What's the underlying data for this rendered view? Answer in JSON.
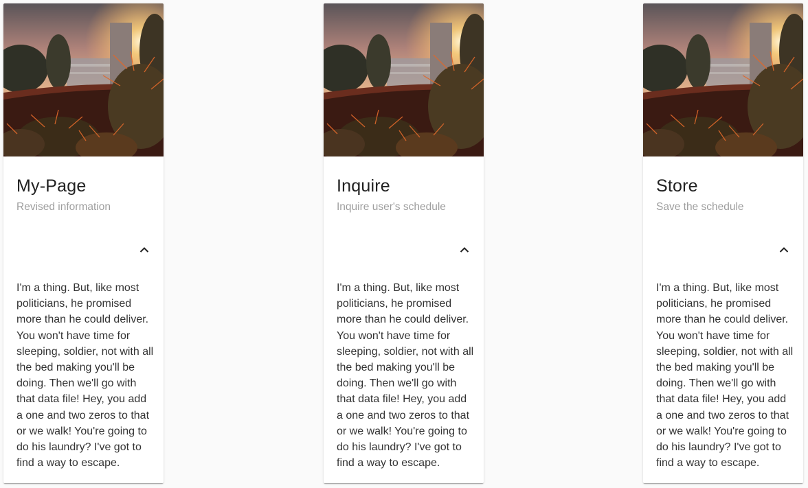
{
  "cards": [
    {
      "title": "My-Page",
      "subtitle": "Revised information",
      "expand_icon": "chevron-up-icon",
      "body": "I'm a thing. But, like most politicians, he promised more than he could deliver. You won't have time for sleeping, soldier, not with all the bed making you'll be doing. Then we'll go with that data file! Hey, you add a one and two zeros to that or we walk! You're going to do his laundry? I've got to find a way to escape."
    },
    {
      "title": "Inquire",
      "subtitle": "Inquire user's schedule",
      "expand_icon": "chevron-up-icon",
      "body": "I'm a thing. But, like most politicians, he promised more than he could deliver. You won't have time for sleeping, soldier, not with all the bed making you'll be doing. Then we'll go with that data file! Hey, you add a one and two zeros to that or we walk! You're going to do his laundry? I've got to find a way to escape."
    },
    {
      "title": "Store",
      "subtitle": "Save the schedule",
      "expand_icon": "chevron-up-icon",
      "body": "I'm a thing. But, like most politicians, he promised more than he could deliver. You won't have time for sleeping, soldier, not with all the bed making you'll be doing. Then we'll go with that data file! Hey, you add a one and two zeros to that or we walk! You're going to do his laundry? I've got to find a way to escape."
    }
  ],
  "colors": {
    "page_background": "#fafafa",
    "card_background": "#ffffff",
    "title": "#212121",
    "subtitle": "#9e9e9e",
    "body": "#333333"
  }
}
